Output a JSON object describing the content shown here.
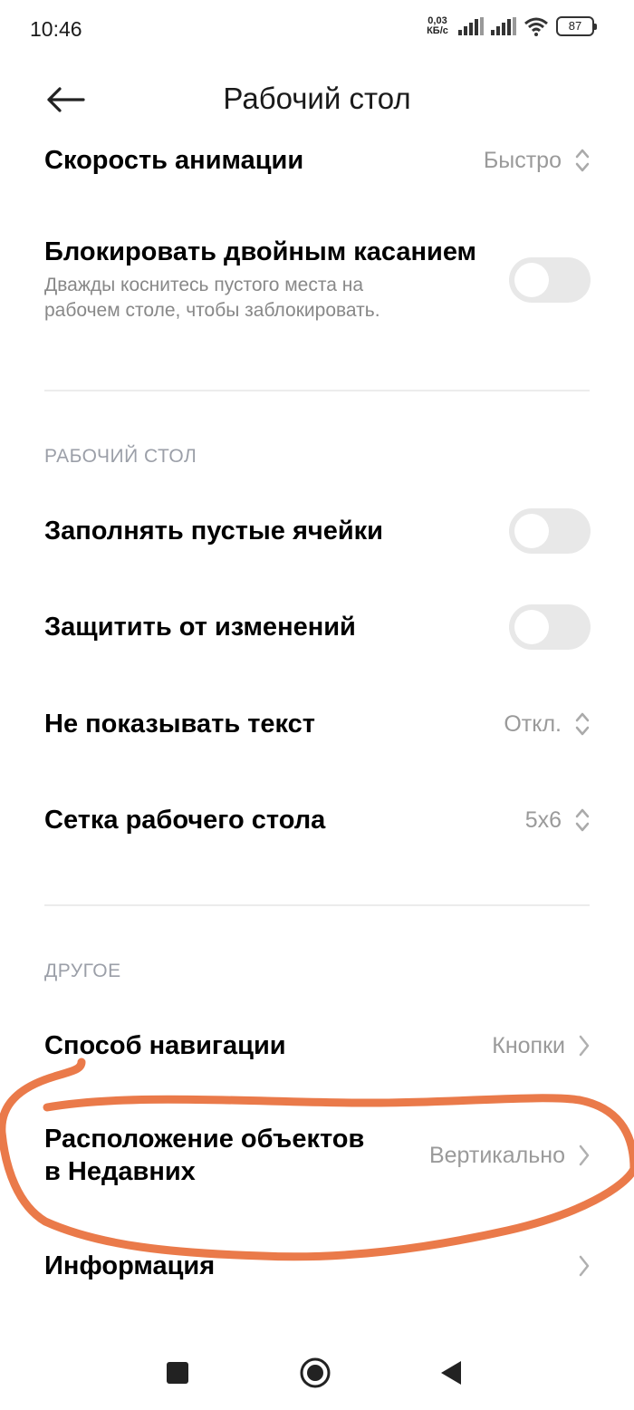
{
  "status_bar": {
    "time": "10:46",
    "net_speed_value": "0,03",
    "net_speed_unit": "КБ/с",
    "battery": "87"
  },
  "header": {
    "title": "Рабочий стол"
  },
  "settings": {
    "animation_speed": {
      "label": "Скорость анимации",
      "value": "Быстро"
    },
    "double_tap_lock": {
      "label": "Блокировать двойным касанием",
      "description_line1": "Дважды коснитесь пустого места на",
      "description_line2": "рабочем столе, чтобы заблокировать.",
      "enabled": false
    },
    "section_desktop": "РАБОЧИЙ СТОЛ",
    "fill_empty_cells": {
      "label": "Заполнять пустые ячейки",
      "enabled": false
    },
    "protect_changes": {
      "label": "Защитить от изменений",
      "enabled": false
    },
    "hide_text": {
      "label": "Не показывать текст",
      "value": "Откл."
    },
    "desktop_grid": {
      "label": "Сетка рабочего стола",
      "value": "5x6"
    },
    "section_other": "ДРУГОЕ",
    "navigation_method": {
      "label": "Способ навигации",
      "value": "Кнопки"
    },
    "recents_layout": {
      "label_line1": "Расположение объектов",
      "label_line2": "в Недавних",
      "value": "Вертикально"
    },
    "info": {
      "label": "Информация"
    }
  },
  "colors": {
    "annotation_stroke": "#ea7a4a",
    "toggle_off": "#e8e8e8",
    "secondary_text": "#9a9a9a"
  },
  "icons": {
    "back": "arrow-left-icon",
    "selector": "up-down-chevron-icon",
    "chevron": "chevron-right-icon",
    "nav_recents": "square-icon",
    "nav_home": "circle-icon",
    "nav_back": "triangle-left-icon"
  }
}
